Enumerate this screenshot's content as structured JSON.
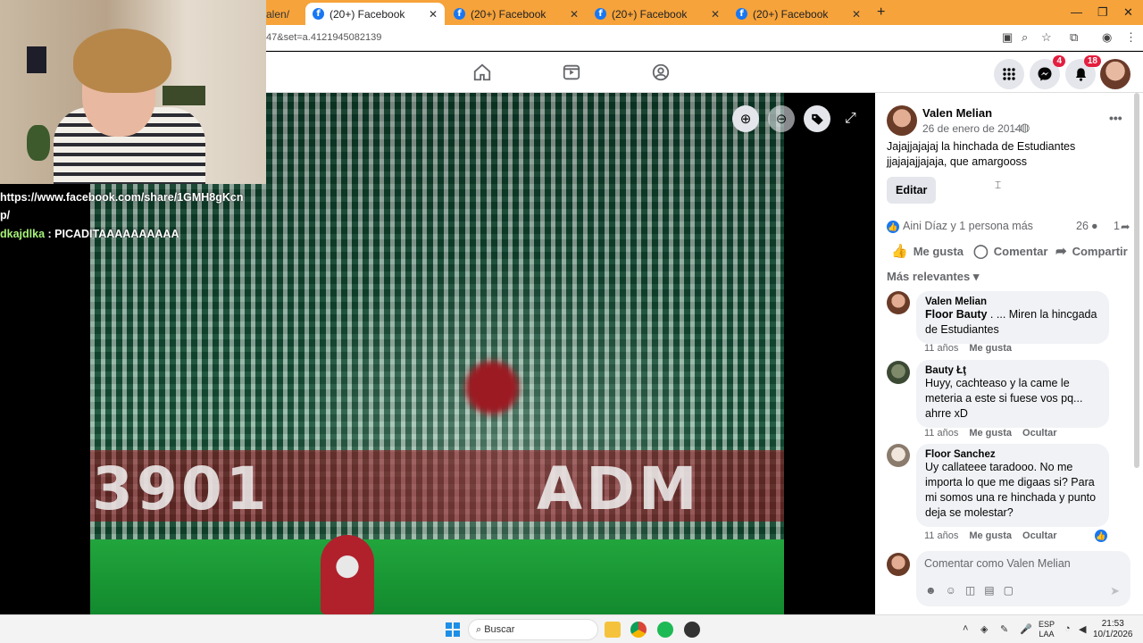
{
  "browser": {
    "tabs": [
      {
        "title": "(20+) Facebook",
        "active": true
      },
      {
        "title": "(20+) Facebook",
        "active": false
      },
      {
        "title": "(20+) Facebook",
        "active": false
      },
      {
        "title": "(20+) Facebook",
        "active": false
      }
    ],
    "partial_tab": "alen/",
    "url": "47&set=a.4121945082139",
    "favicon_letter": "f",
    "close_glyph": "✕"
  },
  "fbnav": {
    "messenger_badge": "4",
    "notifications_badge": "18"
  },
  "stream_overlay": {
    "chat": [
      {
        "user": "",
        "text": "https://www.facebook.com/share/1GMH8gKcn"
      },
      {
        "user": "",
        "text": "p/"
      },
      {
        "user": "dkajdlka",
        "text": " : PICADITAAAAAAAAAA"
      }
    ]
  },
  "photo": {
    "banner_left": "3901",
    "banner_right": "ADM"
  },
  "post": {
    "author": "Valen Melian",
    "date": "26 de enero de 2014",
    "date_sep": "·",
    "text": "Jajajjajajaj la hinchada de Estudiantes jjajajajjajaja, que amargooss",
    "edit_label": "Editar",
    "reactions_text": "Aini Díaz y 1 persona más",
    "comments_count": "26",
    "shares_count": "1",
    "actions": {
      "like": "Me gusta",
      "comment": "Comentar",
      "share": "Compartir"
    },
    "sort_label": "Más relevantes"
  },
  "comments": [
    {
      "author": "Valen Melian",
      "mention": "Floor Bauty",
      "text": " . ... Miren la hincgada de Estudiantes",
      "age": "11 años",
      "like": "Me gusta",
      "hide": ""
    },
    {
      "author": "Bauty Łţ",
      "mention": "",
      "text": "Huyy, cachteaso y la came le meteria a este si fuese vos pq... ahrre xD",
      "age": "11 años",
      "like": "Me gusta",
      "hide": "Ocultar"
    },
    {
      "author": "Floor Sanchez",
      "mention": "",
      "text": "Uy callateee taradooo. No me importa lo que me digaas si? Para mi somos una re hinchada y punto deja se molestar?",
      "age": "11 años",
      "like": "Me gusta",
      "hide": "Ocultar"
    }
  ],
  "compose": {
    "placeholder": "Comentar como Valen Melian"
  },
  "taskbar": {
    "search": "Buscar",
    "lang_top": "ESP",
    "lang_bottom": "LAA",
    "time": "21:53",
    "date": "10/1/2026"
  },
  "colors": {
    "tabbar": "#f6a33b",
    "accent": "#1877f2",
    "badge": "#e41e3f"
  }
}
